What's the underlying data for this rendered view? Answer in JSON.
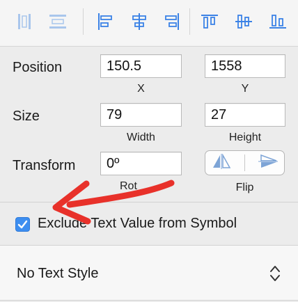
{
  "toolbar": {
    "icons": [
      "distribute-horizontal-icon",
      "distribute-vertical-icon",
      "align-left-icon",
      "align-center-horizontal-icon",
      "align-right-icon",
      "align-top-icon",
      "align-middle-vertical-icon",
      "align-bottom-icon"
    ]
  },
  "position": {
    "label": "Position",
    "x": "150.5",
    "y": "1558",
    "x_label": "X",
    "y_label": "Y"
  },
  "size": {
    "label": "Size",
    "width": "79",
    "height": "27",
    "width_label": "Width",
    "height_label": "Height"
  },
  "transform": {
    "label": "Transform",
    "rotate": "0º",
    "rotate_label_partial": "Rot",
    "flip_label": "Flip"
  },
  "exclude": {
    "label": "Exclude Text Value from Symbol",
    "checked": true
  },
  "text_style": {
    "value": "No Text Style"
  },
  "colors": {
    "accent": "#3d8ef0",
    "arrow": "#e8312a",
    "icon_blue": "#3b82e6"
  }
}
